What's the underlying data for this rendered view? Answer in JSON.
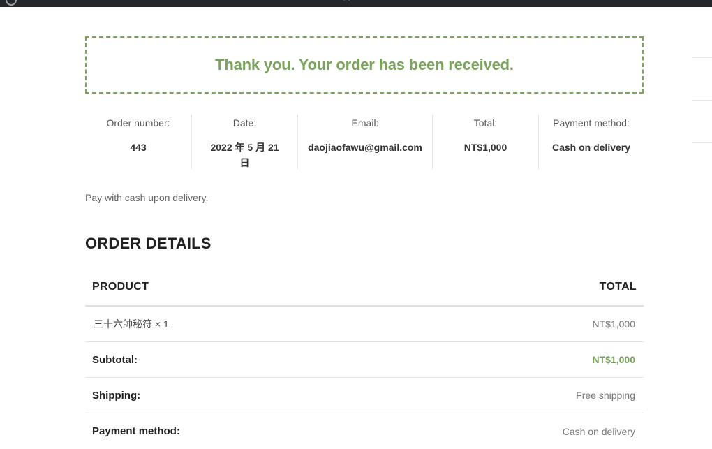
{
  "notice": {
    "message": "Thank you. Your order has been received."
  },
  "overview": [
    {
      "label": "Order number:",
      "value": "443"
    },
    {
      "label": "Date:",
      "value": "2022 年 5 月 21 日"
    },
    {
      "label": "Email:",
      "value": "daojiaofawu@gmail.com"
    },
    {
      "label": "Total:",
      "value": "NT$1,000"
    },
    {
      "label": "Payment method:",
      "value": "Cash on delivery"
    }
  ],
  "payment_note": "Pay with cash upon delivery.",
  "order_details": {
    "title": "ORDER DETAILS",
    "header": {
      "product": "PRODUCT",
      "total": "TOTAL"
    },
    "item": {
      "name": "三十六帥秘符",
      "qty": "× 1",
      "total": "NT$1,000"
    },
    "subtotal": {
      "label": "Subtotal:",
      "value": "NT$1,000"
    },
    "shipping": {
      "label": "Shipping:",
      "value": "Free shipping"
    },
    "payment": {
      "label": "Payment method:",
      "value": "Cash on delivery"
    }
  },
  "colors": {
    "accent": "#7aa35c",
    "admin_bar": "#23282d"
  }
}
